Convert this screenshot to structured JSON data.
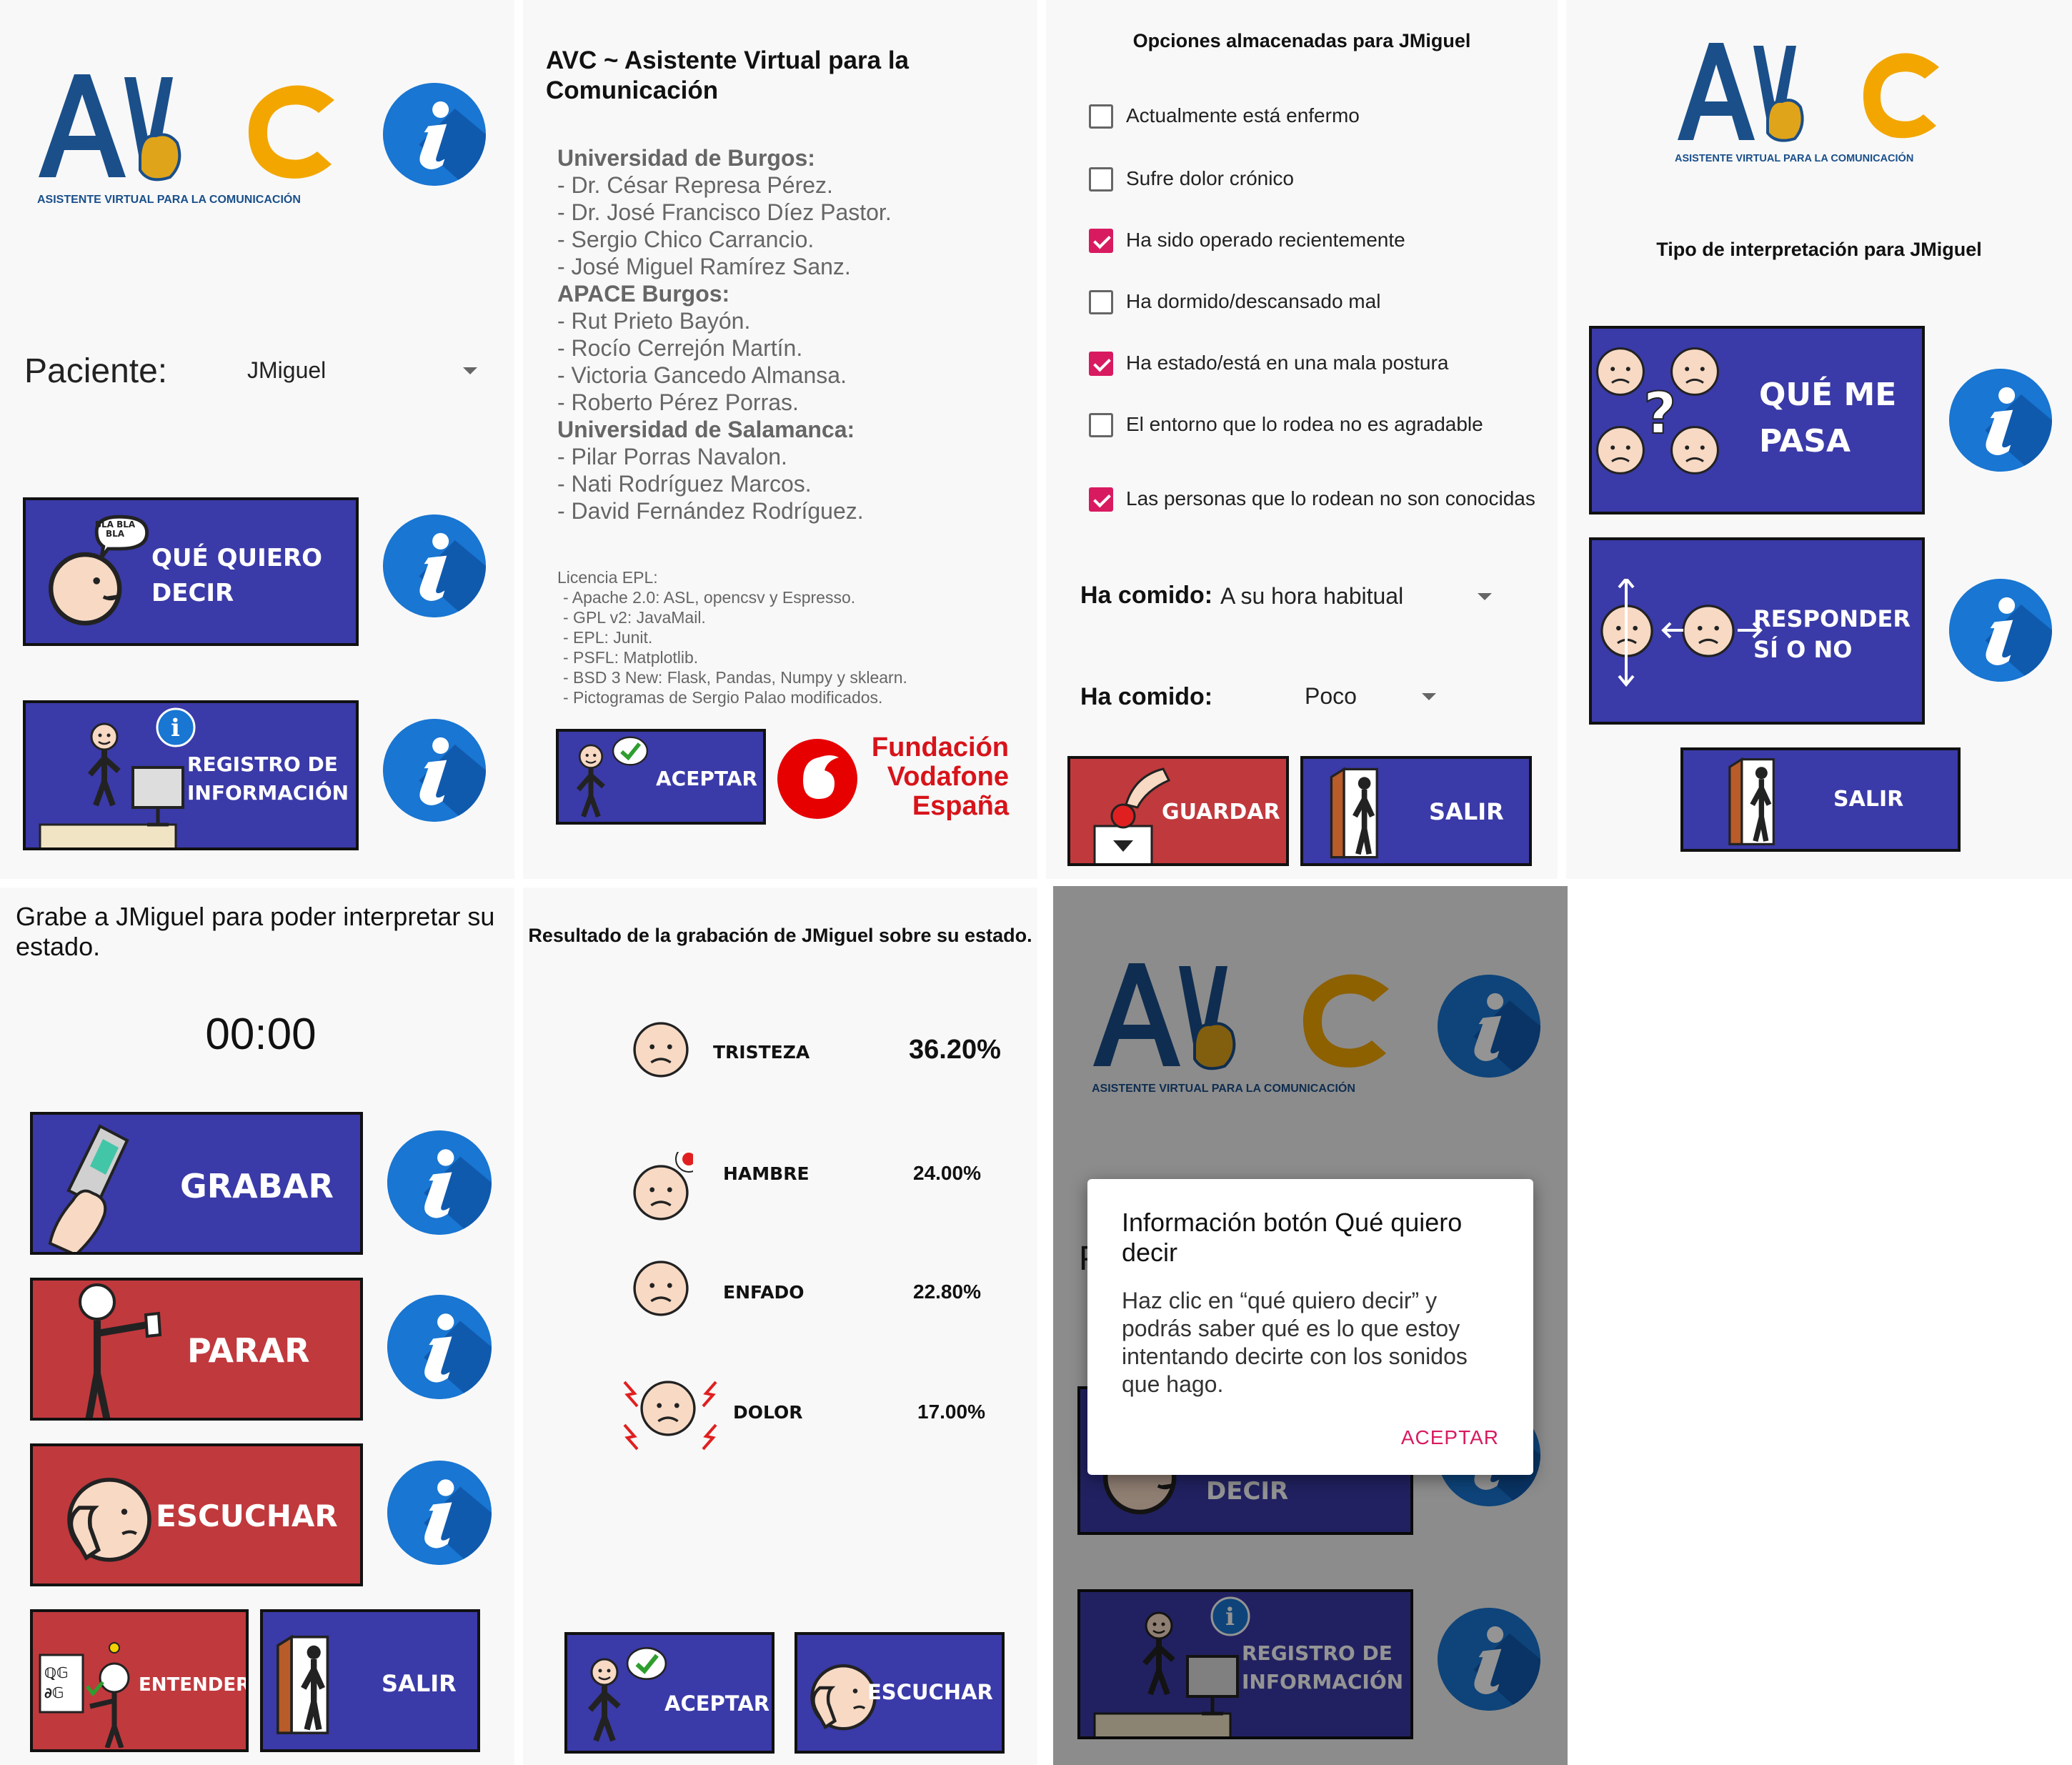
{
  "logo": {
    "brand_text": "AVC",
    "tagline": "ASISTENTE VIRTUAL PARA LA COMUNICACIÓN"
  },
  "colors": {
    "blue_button": "#3a3aa8",
    "red_button": "#c0393d",
    "info_blue": "#1976d2",
    "accent_pink": "#d81b60",
    "logo_blue": "#1a4f8a",
    "logo_orange": "#f3a600"
  },
  "screen1": {
    "patient_label": "Paciente:",
    "patient_value": "JMiguel",
    "btn_que_quiero_line1": "QUÉ QUIERO",
    "btn_que_quiero_line2": "DECIR",
    "btn_registro_line1": "REGISTRO DE",
    "btn_registro_line2": "INFORMACIÓN",
    "bubble_text_1": "BLA BLA",
    "bubble_text_2": "BLA"
  },
  "screen2": {
    "title": "AVC ~ Asistente Virtual para la Comunicación",
    "credits": [
      {
        "text": "Universidad de Burgos:",
        "heading": true
      },
      {
        "text": "- Dr. César Represa Pérez.",
        "heading": false
      },
      {
        "text": "- Dr. José Francisco Díez Pastor.",
        "heading": false
      },
      {
        "text": "- Sergio Chico Carrancio.",
        "heading": false
      },
      {
        "text": "- José Miguel Ramírez Sanz.",
        "heading": false
      },
      {
        "text": "APACE Burgos:",
        "heading": true
      },
      {
        "text": "- Rut Prieto Bayón.",
        "heading": false
      },
      {
        "text": "- Rocío Cerrejón Martín.",
        "heading": false
      },
      {
        "text": "- Victoria Gancedo Almansa.",
        "heading": false
      },
      {
        "text": "- Roberto Pérez Porras.",
        "heading": false
      },
      {
        "text": "Universidad de Salamanca:",
        "heading": true
      },
      {
        "text": "- Pilar Porras Navalon.",
        "heading": false
      },
      {
        "text": "- Nati Rodríguez Marcos.",
        "heading": false
      },
      {
        "text": "- David Fernández Rodríguez.",
        "heading": false
      }
    ],
    "licenses": [
      "Licencia EPL:",
      "- Apache 2.0: ASL, opencsv y Espresso.",
      "- GPL v2: JavaMail.",
      "- EPL: Junit.",
      "- PSFL: Matplotlib.",
      "- BSD 3 New: Flask, Pandas, Numpy y sklearn.",
      "- Pictogramas de Sergio Palao modificados."
    ],
    "accept": "ACEPTAR",
    "sponsor": [
      "Fundación",
      "Vodafone",
      "España"
    ]
  },
  "screen3": {
    "title": "Opciones almacenadas para JMiguel",
    "options": [
      {
        "label": "Actualmente está enfermo",
        "checked": false
      },
      {
        "label": "Sufre dolor crónico",
        "checked": false
      },
      {
        "label": "Ha sido operado recientemente",
        "checked": true
      },
      {
        "label": "Ha dormido/descansado mal",
        "checked": false
      },
      {
        "label": "Ha estado/está en una mala postura",
        "checked": true
      },
      {
        "label": "El entorno que lo rodea no es agradable",
        "checked": false
      },
      {
        "label": "Las personas que lo rodean no son conocidas",
        "checked": true
      }
    ],
    "ate_label": "Ha comido:",
    "ate_when": "A su hora habitual",
    "ate_label2": "Ha comido:",
    "ate_amount": "Poco",
    "save": "GUARDAR",
    "exit": "SALIR"
  },
  "screen4": {
    "title": "Tipo de interpretación para JMiguel",
    "btn1_line1": "QUÉ ME",
    "btn1_line2": "PASA",
    "btn2_line1": "RESPONDER",
    "btn2_line2": "SÍ O NO",
    "exit": "SALIR"
  },
  "screen5": {
    "prompt": "Grabe a JMiguel para poder interpretar su estado.",
    "timer": "00:00",
    "record": "GRABAR",
    "stop": "PARAR",
    "listen": "ESCUCHAR",
    "understand": "ENTENDER",
    "exit": "SALIR"
  },
  "screen6": {
    "title": "Resultado de la grabación de JMiguel sobre su estado.",
    "results": [
      {
        "label": "TRISTEZA",
        "value": "36.20%"
      },
      {
        "label": "HAMBRE",
        "value": "24.00%"
      },
      {
        "label": "ENFADO",
        "value": "22.80%"
      },
      {
        "label": "DOLOR",
        "value": "17.00%"
      }
    ],
    "accept": "ACEPTAR",
    "listen": "ESCUCHAR"
  },
  "screen7": {
    "dialog_title": "Información botón Qué quiero decir",
    "dialog_body": "Haz clic en  “qué quiero decir” y podrás saber qué es lo que estoy intentando decirte con los sonidos que hago.",
    "dialog_button": "ACEPTAR",
    "bg_btn_text": "DECIR",
    "bg_registro_line1": "REGISTRO DE",
    "bg_registro_line2": "INFORMACIÓN",
    "bg_partial_text": "P"
  }
}
